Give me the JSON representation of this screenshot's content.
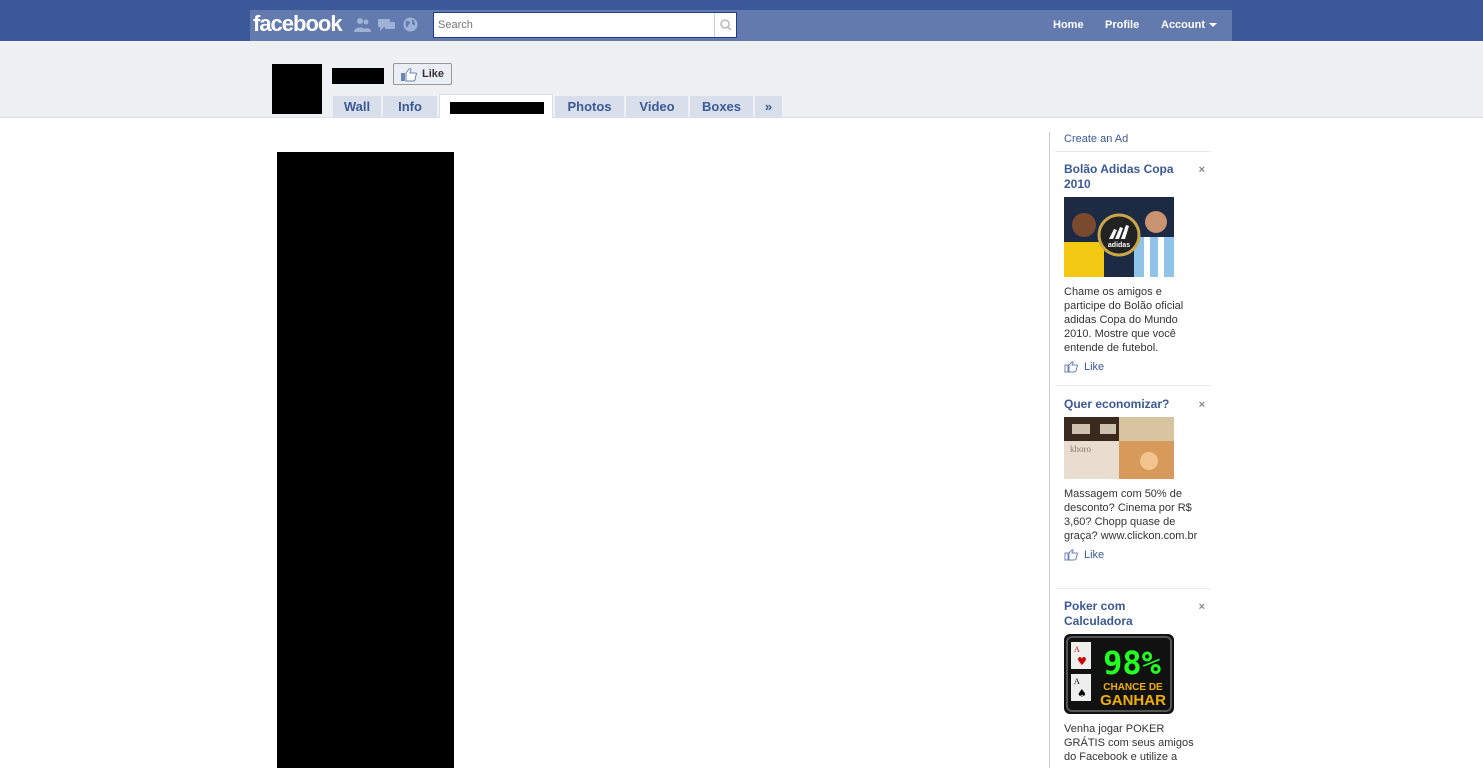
{
  "topbar": {
    "logo": "facebook",
    "search_placeholder": "Search",
    "nav": {
      "home": "Home",
      "profile": "Profile",
      "account": "Account"
    }
  },
  "header": {
    "like_label": "Like",
    "tabs": [
      "Wall",
      "Info",
      "",
      "Photos",
      "Video",
      "Boxes",
      "»"
    ]
  },
  "sidebar": {
    "create_ad": "Create an Ad",
    "ads": [
      {
        "title": "Bolão Adidas Copa 2010",
        "body": "Chame os amigos e participe do Bolão oficial adidas Copa do Mundo 2010. Mostre que você entende de futebol.",
        "like": "Like",
        "image_text": "adidas"
      },
      {
        "title": "Quer economizar?",
        "body": "Massagem com 50% de desconto? Cinema por R$ 3,60? Chopp quase de graça? www.clickon.com.br",
        "like": "Like",
        "image_text": "khoro"
      },
      {
        "title": "Poker com Calculadora",
        "body": "Venha jogar POKER GRÁTIS com seus amigos do Facebook e utilize a",
        "image_text_big": "98%",
        "image_text_small_1": "CHANCE DE",
        "image_text_small_2": "GANHAR"
      }
    ],
    "close_glyph": "×"
  },
  "colors": {
    "brand": "#3b5998",
    "brand_light": "#627aad",
    "header_bg": "#eff0f4"
  }
}
